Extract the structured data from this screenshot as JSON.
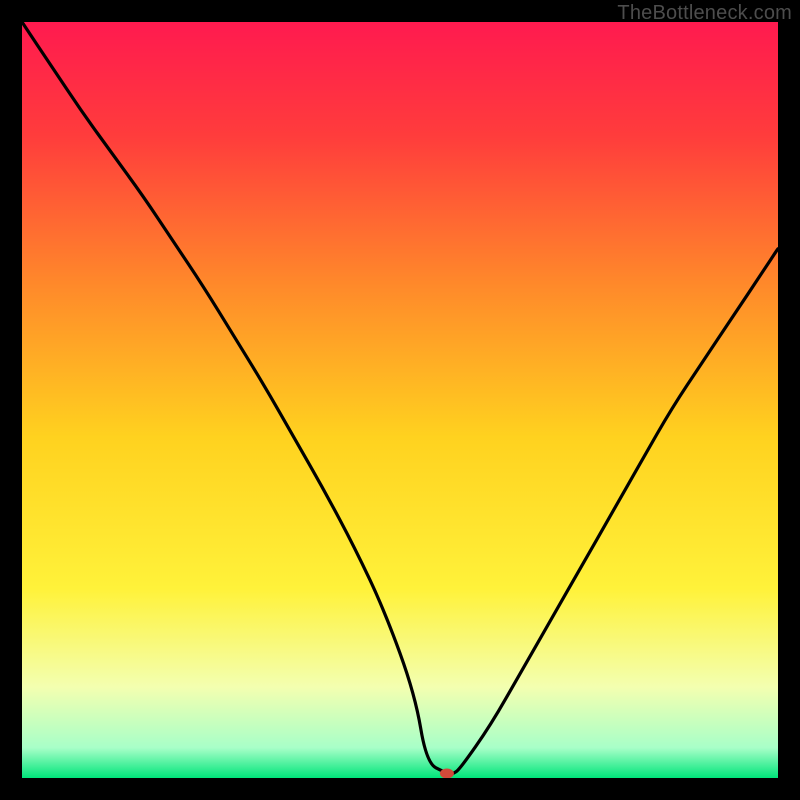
{
  "watermark": "TheBottleneck.com",
  "chart_data": {
    "type": "line",
    "title": "",
    "xlabel": "",
    "ylabel": "",
    "xlim": [
      0,
      100
    ],
    "ylim": [
      0,
      100
    ],
    "grid": false,
    "legend": false,
    "background_gradient": {
      "stops": [
        {
          "offset": 0.0,
          "color": "#ff1a4f"
        },
        {
          "offset": 0.15,
          "color": "#ff3c3c"
        },
        {
          "offset": 0.35,
          "color": "#ff8a2a"
        },
        {
          "offset": 0.55,
          "color": "#ffd21f"
        },
        {
          "offset": 0.75,
          "color": "#fff23a"
        },
        {
          "offset": 0.88,
          "color": "#f3ffb0"
        },
        {
          "offset": 0.96,
          "color": "#a8ffc8"
        },
        {
          "offset": 1.0,
          "color": "#00e57a"
        }
      ]
    },
    "series": [
      {
        "name": "bottleneck-curve",
        "x": [
          0,
          4,
          8,
          12,
          16,
          20,
          24,
          28,
          32,
          36,
          40,
          44,
          48,
          52,
          53.5,
          56,
          57,
          58,
          62,
          66,
          70,
          74,
          78,
          82,
          86,
          90,
          94,
          98,
          100
        ],
        "y": [
          100,
          94,
          88,
          82.5,
          77,
          71,
          65,
          58.5,
          52,
          45,
          38,
          30.5,
          22,
          11,
          2,
          0.7,
          0.5,
          1.3,
          7,
          14,
          21,
          28,
          35,
          42,
          49,
          55,
          61,
          67,
          70
        ]
      }
    ],
    "marker": {
      "name": "optimal-point",
      "x": 56.2,
      "y": 0.6,
      "color": "#d24a3a",
      "rx": 7,
      "ry": 5
    }
  }
}
